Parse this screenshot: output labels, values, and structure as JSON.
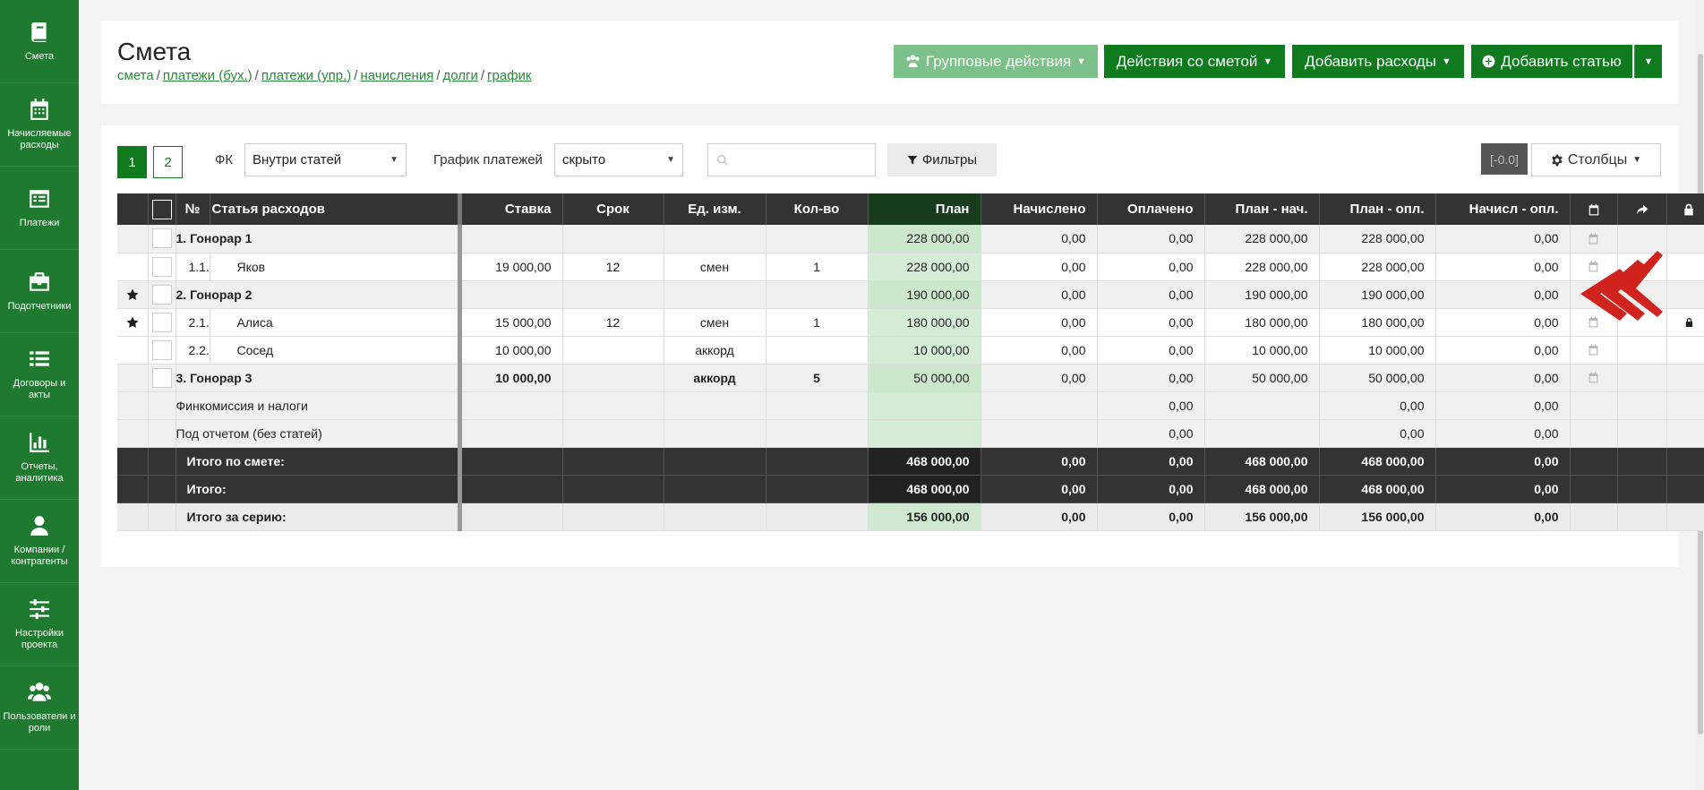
{
  "sidebar": {
    "items": [
      {
        "label": "Смета",
        "icon": "book-icon"
      },
      {
        "label": "Начисляемые расходы",
        "icon": "calendar-icon"
      },
      {
        "label": "Платежи",
        "icon": "list-alt-icon"
      },
      {
        "label": "Подотчетники",
        "icon": "briefcase-icon"
      },
      {
        "label": "Договоры и акты",
        "icon": "list-icon"
      },
      {
        "label": "Отчеты, аналитика",
        "icon": "bar-chart-icon"
      },
      {
        "label": "Компании / контрагенты",
        "icon": "user-icon"
      },
      {
        "label": "Настройки проекта",
        "icon": "sliders-icon"
      },
      {
        "label": "Пользователи и роли",
        "icon": "users-icon"
      }
    ]
  },
  "header": {
    "title": "Смета",
    "breadcrumbs": [
      "смета",
      "платежи (бух.)",
      "платежи (упр.)",
      "начисления",
      "долги",
      "график"
    ],
    "buttons": {
      "group_actions": "Групповые действия",
      "estimate_actions": "Действия со сметой",
      "add_expenses": "Добавить расходы",
      "add_item": "Добавить статью"
    }
  },
  "toolbar": {
    "pages": [
      "1",
      "2"
    ],
    "fk_label": "ФК",
    "fk_value": "Внутри статей",
    "schedule_label": "График платежей",
    "schedule_value": "скрыто",
    "search_placeholder": "",
    "filters_label": "Фильтры",
    "zero_badge": "[-0.0]",
    "columns_label": "Столбцы"
  },
  "table": {
    "headers": {
      "num": "№",
      "item": "Статья расходов",
      "rate": "Ставка",
      "term": "Срок",
      "unit": "Ед. изм.",
      "qty": "Кол-во",
      "plan": "План",
      "accrued": "Начислено",
      "paid": "Оплачено",
      "plan_minus_accrued": "План - нач.",
      "plan_minus_paid": "План - опл.",
      "accrued_minus_paid": "Начисл - опл."
    },
    "rows": [
      {
        "type": "grp",
        "star": false,
        "num": "1.",
        "name": "Гонорар 1",
        "rate": "",
        "term": "",
        "unit": "",
        "qty": "",
        "plan": "228 000,00",
        "accrued": "0,00",
        "paid": "0,00",
        "pn": "228 000,00",
        "po": "228 000,00",
        "no": "0,00",
        "cal": true,
        "lock": false,
        "dd": true
      },
      {
        "type": "sub",
        "star": false,
        "num": "1.1.",
        "name": "Яков",
        "rate": "19 000,00",
        "term": "12",
        "unit": "смен",
        "qty": "1",
        "plan": "228 000,00",
        "accrued": "0,00",
        "paid": "0,00",
        "pn": "228 000,00",
        "po": "228 000,00",
        "no": "0,00",
        "cal": true,
        "lock": false,
        "dd": false
      },
      {
        "type": "grp",
        "star": true,
        "num": "2.",
        "name": "Гонорар 2",
        "rate": "",
        "term": "",
        "unit": "",
        "qty": "",
        "plan": "190 000,00",
        "accrued": "0,00",
        "paid": "0,00",
        "pn": "190 000,00",
        "po": "190 000,00",
        "no": "0,00",
        "cal": true,
        "lock": false,
        "dd": false
      },
      {
        "type": "sub",
        "star": true,
        "num": "2.1.",
        "name": "Алиса",
        "rate": "15 000,00",
        "term": "12",
        "unit": "смен",
        "qty": "1",
        "plan": "180 000,00",
        "accrued": "0,00",
        "paid": "0,00",
        "pn": "180 000,00",
        "po": "180 000,00",
        "no": "0,00",
        "cal": true,
        "lock": true,
        "dd": true
      },
      {
        "type": "sub",
        "star": false,
        "num": "2.2.",
        "name": "Сосед",
        "rate": "10 000,00",
        "term": "",
        "unit": "аккорд",
        "qty": "",
        "plan": "10 000,00",
        "accrued": "0,00",
        "paid": "0,00",
        "pn": "10 000,00",
        "po": "10 000,00",
        "no": "0,00",
        "cal": true,
        "lock": false,
        "dd": true
      },
      {
        "type": "grp",
        "star": false,
        "num": "3.",
        "name": "Гонорар 3",
        "rate": "10 000,00",
        "term": "",
        "unit": "аккорд",
        "qty": "5",
        "plan": "50 000,00",
        "accrued": "0,00",
        "paid": "0,00",
        "pn": "50 000,00",
        "po": "50 000,00",
        "no": "0,00",
        "cal": true,
        "lock": false,
        "dd": true
      }
    ],
    "misc_rows": [
      {
        "name": "Финкомиссия и налоги",
        "paid": "0,00",
        "po": "0,00",
        "no": "0,00"
      },
      {
        "name": "Под отчетом (без статей)",
        "paid": "0,00",
        "po": "0,00",
        "no": "0,00"
      }
    ],
    "totals": [
      {
        "style": "dark",
        "name": "Итого по смете:",
        "plan": "468 000,00",
        "accrued": "0,00",
        "paid": "0,00",
        "pn": "468 000,00",
        "po": "468 000,00",
        "no": "0,00"
      },
      {
        "style": "dark",
        "name": "Итого:",
        "plan": "468 000,00",
        "accrued": "0,00",
        "paid": "0,00",
        "pn": "468 000,00",
        "po": "468 000,00",
        "no": "0,00"
      },
      {
        "style": "light",
        "name": "Итого за серию:",
        "plan": "156 000,00",
        "accrued": "0,00",
        "paid": "0,00",
        "pn": "156 000,00",
        "po": "156 000,00",
        "no": "0,00"
      }
    ]
  },
  "colors": {
    "brand_green": "#0f7a1e",
    "sidebar_green": "#1e7a2e",
    "plan_highlight": "#d5edd6",
    "annotation_red": "#d0231d"
  }
}
